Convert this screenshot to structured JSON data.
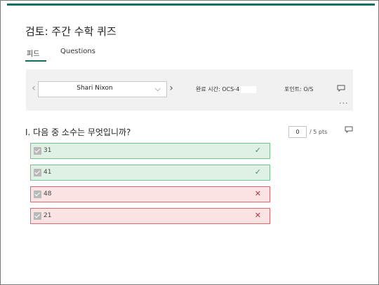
{
  "page": {
    "title": "검토: 주간 수학 퀴즈",
    "accent_color": "#0e6e5f"
  },
  "tabs": [
    {
      "label": "피드",
      "active": true
    },
    {
      "label": "Questions",
      "active": false
    }
  ],
  "response_panel": {
    "prev_icon": "chevron-left-icon",
    "next_icon": "chevron-right-icon",
    "respondent_name": "Shari Nixon",
    "completion_time": "완료 시간: OCS-4",
    "points": "포인트: O/S",
    "comment_icon": "comment-icon",
    "more_icon": "ellipsis-icon"
  },
  "question": {
    "text": "I. 다음 중 소수는 무엇입니까?",
    "score_value": "0",
    "score_suffix": "/ 5 pts",
    "comment_icon": "comment-icon"
  },
  "options": [
    {
      "label": "31",
      "status": "correct",
      "mark": "✓",
      "color": "#78c292"
    },
    {
      "label": "41",
      "status": "correct",
      "mark": "✓",
      "color": "#78c292"
    },
    {
      "label": "48",
      "status": "wrong",
      "mark": "✕",
      "color": "#e0686d"
    },
    {
      "label": "21",
      "status": "wrong",
      "mark": "✕",
      "color": "#e0686d"
    }
  ]
}
